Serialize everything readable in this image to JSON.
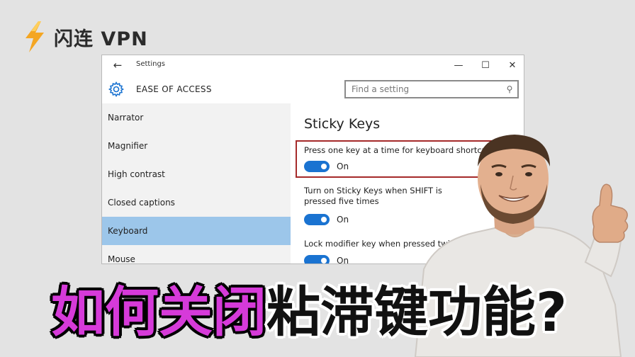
{
  "brand": {
    "name": "闪连 VPN",
    "icon": "lightning-bolt-icon",
    "color": "#f4a623"
  },
  "window": {
    "title": "Settings",
    "back_icon": "back-arrow-icon",
    "minimize": "—",
    "maximize": "☐",
    "close": "✕",
    "section_title": "EASE OF ACCESS",
    "search_placeholder": "Find a setting"
  },
  "sidebar": {
    "items": [
      {
        "label": "Narrator"
      },
      {
        "label": "Magnifier"
      },
      {
        "label": "High contrast"
      },
      {
        "label": "Closed captions"
      },
      {
        "label": "Keyboard",
        "active": true
      },
      {
        "label": "Mouse"
      }
    ]
  },
  "content": {
    "title": "Sticky Keys",
    "settings": [
      {
        "label": "Press one key at a time for keyboard shortcuts",
        "state": "On"
      },
      {
        "label": "Turn on Sticky Keys when SHIFT is pressed five times",
        "state": "On"
      },
      {
        "label": "Lock modifier key when pressed twice in a row",
        "state": "On"
      }
    ]
  },
  "caption": {
    "part1": "如何关闭",
    "part2": "粘滞键功能?",
    "color1": "#d63ad9",
    "color2": "#111111"
  },
  "colors": {
    "accent": "#1a73d1",
    "active_nav": "#9cc6ea",
    "highlight": "#a52a2a"
  }
}
